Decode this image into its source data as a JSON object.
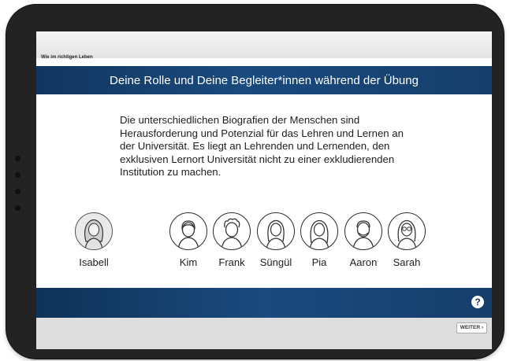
{
  "breadcrumb": "Wie im richtigen Leben",
  "title": "Deine Rolle und Deine Begleiter*innen während der Übung",
  "intro_text": "Die unterschiedlichen Biografien der Menschen sind Herausforderung und Potenzial für das Lehren und Lernen an der Universität. Es liegt an Lehrenden und Lernenden, den exklusiven Lernort Universität nicht zu einer exkludierenden Institution zu machen.",
  "selected_character": {
    "name": "Isabell",
    "icon": "woman-long-hair-icon"
  },
  "companions": [
    {
      "name": "Kim",
      "icon": "person-short-hair-icon"
    },
    {
      "name": "Frank",
      "icon": "man-curly-hair-icon"
    },
    {
      "name": "Süngül",
      "icon": "woman-long-hair-icon"
    },
    {
      "name": "Pia",
      "icon": "woman-long-hair-icon"
    },
    {
      "name": "Aaron",
      "icon": "man-beard-icon"
    },
    {
      "name": "Sarah",
      "icon": "woman-glasses-icon"
    }
  ],
  "help_label": "?",
  "next_label": "WEITER ›",
  "colors": {
    "accent": "#1a4a7e",
    "footer": "#dedede",
    "device": "#232323"
  }
}
